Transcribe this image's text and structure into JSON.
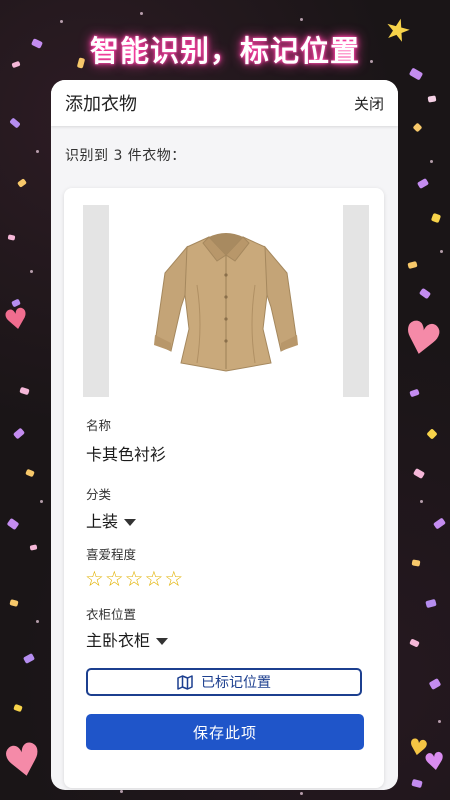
{
  "banner": {
    "text": "智能识别，标记位置"
  },
  "sheet": {
    "title": "添加衣物",
    "close_label": "关闭",
    "detected_text": "识别到 3 件衣物："
  },
  "item": {
    "image_icon": "shirt-icon",
    "name_label": "名称",
    "name_value": "卡其色衬衫",
    "category_label": "分类",
    "category_value": "上装",
    "rating_label": "喜爱程度",
    "rating_value": 0,
    "rating_max": 5,
    "location_label": "衣柜位置",
    "location_value": "主卧衣柜",
    "marked_button": "已标记位置",
    "save_button": "保存此项"
  },
  "colors": {
    "accent": "#1f55c9",
    "outline": "#1c3f8f",
    "star": "#e2b200",
    "banner_glow": "#ff3fa4",
    "shirt": "#c4a477"
  }
}
